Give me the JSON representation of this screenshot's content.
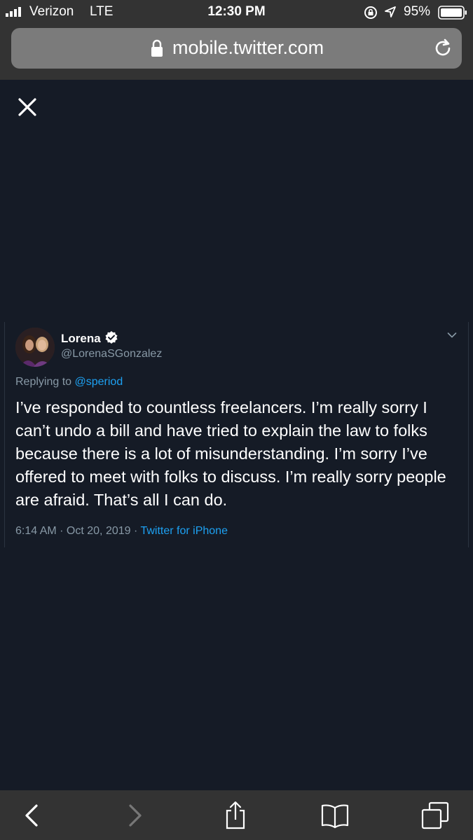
{
  "status_bar": {
    "carrier": "Verizon",
    "network": "LTE",
    "time": "12:30 PM",
    "battery_percent": "95%",
    "icons": [
      "signal-icon",
      "rotation-lock-icon",
      "location-arrow-icon",
      "battery-icon"
    ]
  },
  "browser": {
    "url": "mobile.twitter.com",
    "icons": [
      "lock-icon",
      "reload-icon"
    ]
  },
  "modal": {
    "close_icon": "close-icon"
  },
  "tweet": {
    "author_name": "Lorena",
    "author_handle": "@LorenaSGonzalez",
    "reply_prefix": "Replying to",
    "reply_to": "@speriod",
    "text": "I’ve responded to countless freelancers. I’m really sorry I can’t undo a bill and have tried to explain the law to folks because there is a lot of misunderstanding. I’m sorry I’ve offered to meet with folks to discuss. I’m really sorry people are afraid. That’s all I can do.",
    "timestamp": "6:14 AM · Oct 20, 2019 · ",
    "source": "Twitter for iPhone",
    "verified_color": "#ffffff",
    "link_color": "#1da1f2"
  },
  "toolbar": {
    "icons": [
      "back-icon",
      "forward-icon",
      "share-icon",
      "bookmarks-icon",
      "tabs-icon"
    ]
  }
}
